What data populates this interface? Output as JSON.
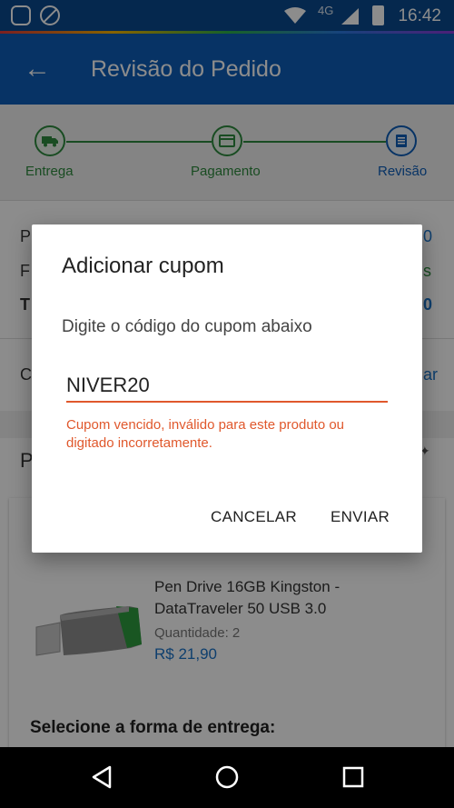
{
  "status_bar": {
    "time": "16:42",
    "network": "4G"
  },
  "app_bar": {
    "title": "Revisão do Pedido"
  },
  "stepper": {
    "steps": [
      {
        "label": "Entrega"
      },
      {
        "label": "Pagamento"
      },
      {
        "label": "Revisão"
      }
    ]
  },
  "product": {
    "name": "Pen Drive 16GB Kingston - DataTraveler 50 USB 3.0",
    "quantity_label": "Quantidade:",
    "quantity_value": "2",
    "price": "R$ 21,90"
  },
  "delivery": {
    "title": "Selecione a forma de entrega:"
  },
  "dialog": {
    "title": "Adicionar cupom",
    "message": "Digite o código do cupom abaixo",
    "coupon_value": "NIVER20",
    "error": "Cupom vencido, inválido para este produto ou digitado incorretamente.",
    "cancel_label": "CANCELAR",
    "send_label": "ENVIAR"
  },
  "colors": {
    "primary": "#0d5db8",
    "success": "#2e8b3e",
    "error": "#e0582c",
    "link": "#1a73c9"
  }
}
